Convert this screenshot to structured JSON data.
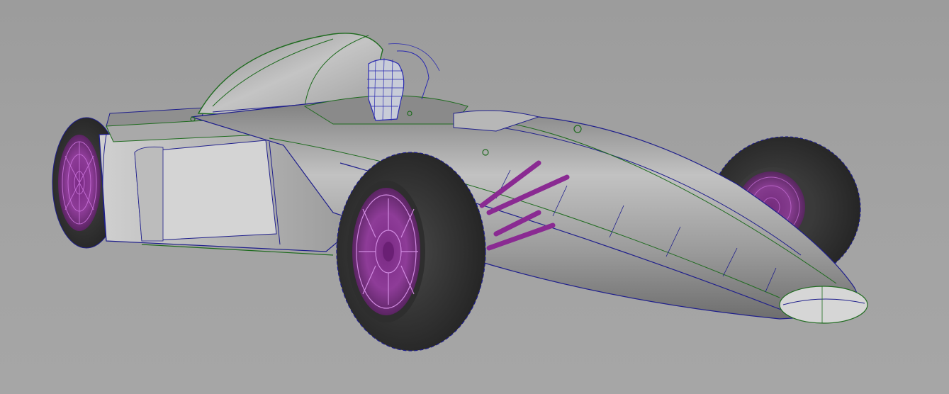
{
  "viewport": {
    "label": "",
    "background": "#a0a0a0"
  },
  "model": {
    "subject": "formula-race-car",
    "display_mode": "smooth-shade-with-wireframe",
    "colors": {
      "body_shade_light": "#c9c9c9",
      "body_shade_dark": "#6f6f6f",
      "tire": "#3a3a3a",
      "tire_dark": "#262626",
      "rim_wire": "#9a2fa8",
      "wire_blue": "#1f1f8c",
      "wire_green": "#1f6b1f",
      "helmet_wire": "#2a2ab0",
      "helmet_fill": "#c8ccd8",
      "suspension": "#8a2a92"
    }
  }
}
